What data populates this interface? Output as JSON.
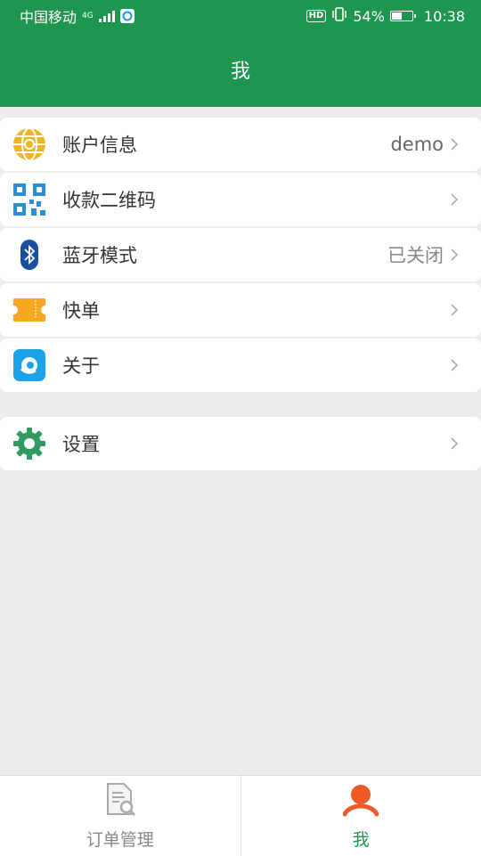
{
  "status_bar": {
    "carrier": "中国移动",
    "network": "4G",
    "signal_bars": 4,
    "hd": "HD",
    "battery_percent": "54%",
    "battery_level": 0.54,
    "time": "10:38"
  },
  "header": {
    "title": "我"
  },
  "menu": {
    "items": [
      {
        "label": "账户信息",
        "value": "demo",
        "icon": "globe-icon"
      },
      {
        "label": "收款二维码",
        "value": "",
        "icon": "qr-code-icon"
      },
      {
        "label": "蓝牙模式",
        "value": "已关闭",
        "icon": "bluetooth-icon"
      },
      {
        "label": "快单",
        "value": "",
        "icon": "ticket-icon"
      },
      {
        "label": "关于",
        "value": "",
        "icon": "app-logo-icon"
      }
    ],
    "settings": {
      "label": "设置",
      "icon": "gear-icon"
    }
  },
  "tabbar": {
    "tabs": [
      {
        "label": "订单管理",
        "icon": "order-search-icon",
        "active": false
      },
      {
        "label": "我",
        "icon": "person-icon",
        "active": true
      }
    ]
  },
  "colors": {
    "brand_green": "#1e9650",
    "active_tab": "#1e9650",
    "inactive_tab": "#888888",
    "person_orange": "#f05a28"
  }
}
